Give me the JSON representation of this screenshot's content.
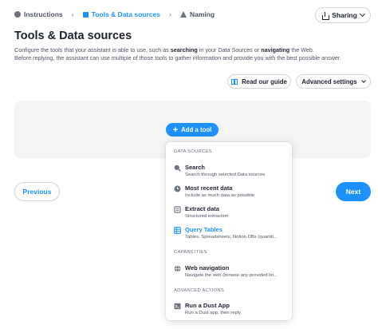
{
  "stepper": {
    "steps": [
      {
        "label": "Instructions"
      },
      {
        "label": "Tools & Data sources"
      },
      {
        "label": "Naming"
      }
    ]
  },
  "header": {
    "sharing_label": "Sharing"
  },
  "page": {
    "title": "Tools & Data sources",
    "description": {
      "p1": "Configure the tools that your assistant is able to use, such as ",
      "b1": "searching",
      "p2": " in your Data Sources or ",
      "b2": "navigating",
      "p3": " the Web.",
      "line2": "Before replying, the assistant can use multiple of those tools to gather information and provide you with the best possible answer."
    }
  },
  "actions": {
    "guide_label": "Read our guide",
    "advanced_label": "Advanced settings"
  },
  "panel": {
    "add_tool_label": "Add a tool"
  },
  "nav": {
    "previous_label": "Previous",
    "next_label": "Next"
  },
  "menu": {
    "data_sources_header": "DATA SOURCES",
    "capabilities_header": "CAPABILITIES",
    "advanced_header": "ADVANCED ACTIONS",
    "items": [
      {
        "title": "Search",
        "subtitle": "Search through selected Data sources",
        "icon": "magnifier-icon"
      },
      {
        "title": "Most recent data",
        "subtitle": "Include as much data as possible",
        "icon": "clock-icon"
      },
      {
        "title": "Extract data",
        "subtitle": "Structured extraction",
        "icon": "scan-icon"
      },
      {
        "title": "Query Tables",
        "subtitle": "Tables, Spreadsheets, Notion DBs (quantit...",
        "icon": "table-icon"
      },
      {
        "title": "Web navigation",
        "subtitle": "Navigate the web (browse any provided lin...",
        "icon": "globe-icon"
      },
      {
        "title": "Run a Dust App",
        "subtitle": "Run a Dust app, then reply",
        "icon": "command-line-icon"
      }
    ]
  },
  "colors": {
    "accent": "#1c91ff",
    "text": "#1c222d",
    "muted": "#6b7280",
    "panel_bg": "#f3f4f6"
  }
}
